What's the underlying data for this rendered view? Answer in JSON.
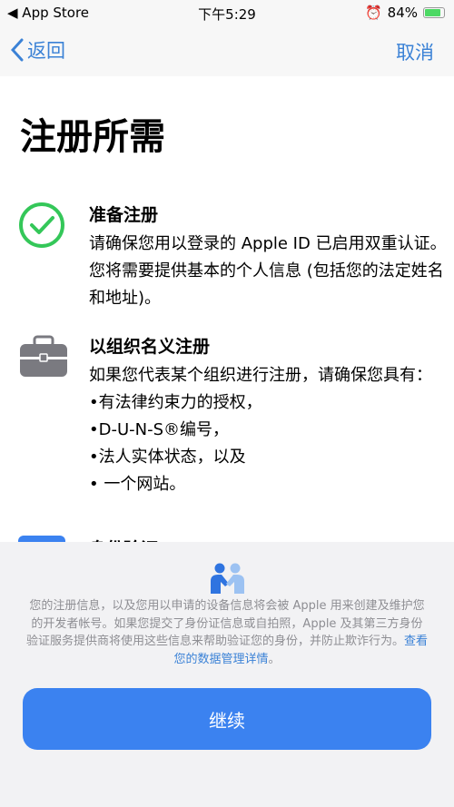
{
  "status_bar": {
    "back_app": "◀ App Store",
    "time": "下午5:29",
    "battery": "84%",
    "battery_level": 0.84
  },
  "nav": {
    "back_label": "返回",
    "cancel_label": "取消"
  },
  "title": "注册所需",
  "sections": [
    {
      "icon": "checkmark-circle-icon",
      "heading": "准备注册",
      "body": "请确保您用以登录的 Apple ID 已启用双重认证。您将需要提供基本的个人信息 (包括您的法定姓名和地址)。"
    },
    {
      "icon": "briefcase-icon",
      "heading": "以组织名义注册",
      "body_lines": [
        "如果您代表某个组织进行注册，请确保您具有：",
        "•有法律约束力的授权，",
        "•D-U-N-S®编号，",
        "•法人实体状态，以及",
        "• 一个网站。"
      ]
    },
    {
      "icon": "id-card-icon",
      "heading": "身份验证"
    }
  ],
  "footer": {
    "icon": "handshake-people-icon",
    "text": "您的注册信息，以及您用以申请的设备信息将会被 Apple 用来创建及维护您的开发者帐号。如果您提交了身份证信息或自拍照，Apple 及其第三方身份验证服务提供商将使用这些信息来帮助验证您的身份，并防止欺诈行为。",
    "link": "查看您的数据管理详情",
    "link_suffix": "。",
    "continue_label": "继续"
  },
  "colors": {
    "accent": "#3b82d6",
    "button": "#3b82f0",
    "check": "#34c759"
  }
}
